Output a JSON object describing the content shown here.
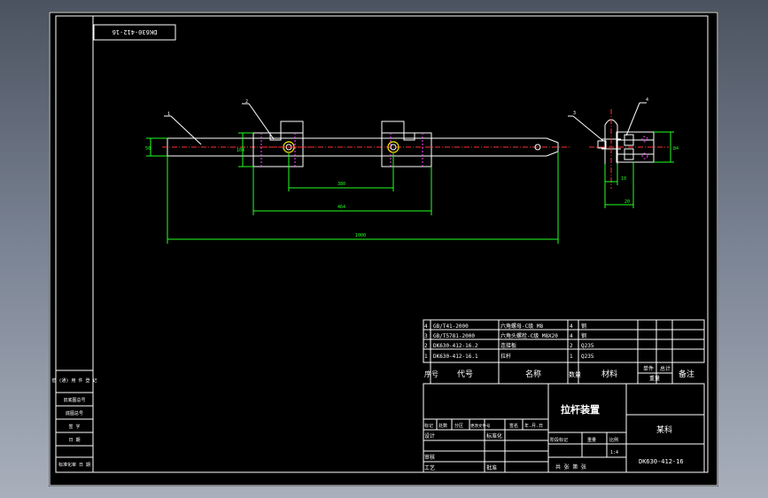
{
  "header_box": {
    "code": "DK630-412-16"
  },
  "drawing": {
    "balloons": [
      "1",
      "2",
      "3",
      "4"
    ],
    "dimensions": [
      "50",
      "104",
      "380",
      "464",
      "1000",
      "10",
      "20",
      "84"
    ]
  },
  "left_strip": {
    "cells": [
      "借 (通) 用 件 登 记",
      "旧底图总号",
      "底图总号",
      "签 字",
      "日 期",
      "标准化审 日 期"
    ]
  },
  "parts_list": {
    "rows": [
      {
        "no": "4",
        "code": "GB/T41-2000",
        "name": "六角螺母-C级 M8",
        "qty": "4",
        "material": "钢",
        "mass_single": "",
        "mass_total": "",
        "remark": ""
      },
      {
        "no": "3",
        "code": "GB/T5781-2000",
        "name": "六角头螺栓-C级 M8X20",
        "qty": "4",
        "material": "钢",
        "mass_single": "",
        "mass_total": "",
        "remark": ""
      },
      {
        "no": "2",
        "code": "DK630-412-16.2",
        "name": "连接板",
        "qty": "2",
        "material": "Q235",
        "mass_single": "",
        "mass_total": "",
        "remark": ""
      },
      {
        "no": "1",
        "code": "DK630-412-16.1",
        "name": "拉杆",
        "qty": "1",
        "material": "Q235",
        "mass_single": "",
        "mass_total": "",
        "remark": ""
      }
    ],
    "header": {
      "no": "序号",
      "code": "代号",
      "name": "名称",
      "qty": "数量",
      "material": "材料",
      "mass_single": "单件",
      "mass_total": "总计",
      "mass_label": "重量",
      "remark": "备注"
    }
  },
  "title_block": {
    "title": "拉杆装置",
    "company": "某科",
    "drawing_no": "DK630-412-16",
    "revision_header": [
      "标记",
      "处数",
      "分区",
      "更改文件号",
      "签名",
      "年.月.日"
    ],
    "roles": [
      "设计",
      "审核",
      "工艺"
    ],
    "standardize_label": "标准化",
    "approve_label": "批准",
    "stage_labels": [
      "阶段标记",
      "重量",
      "比例"
    ],
    "scale": "1:4",
    "sheet_label": "共 张 第 张"
  }
}
